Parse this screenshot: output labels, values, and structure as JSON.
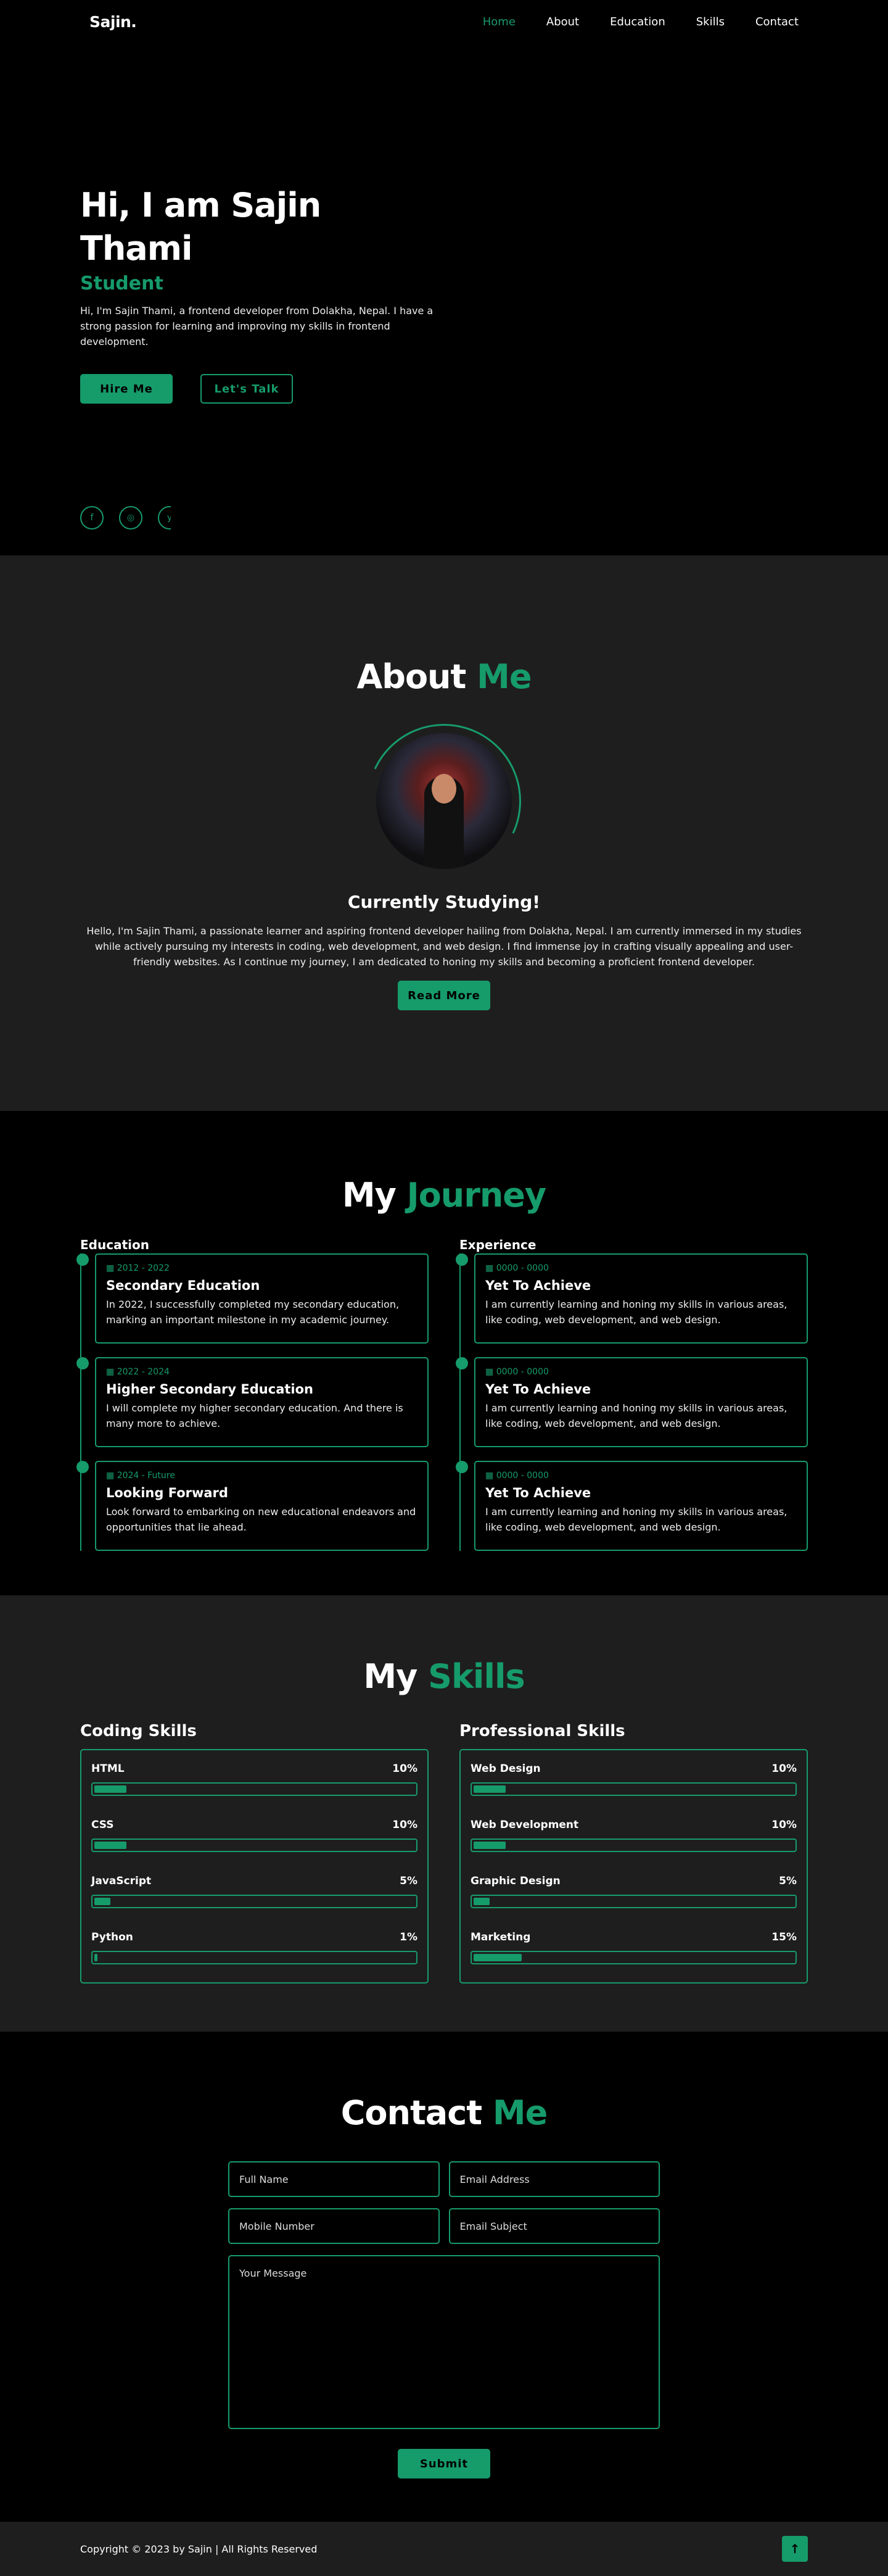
{
  "header": {
    "logo": "Sajin.",
    "nav": [
      "Home",
      "About",
      "Education",
      "Skills",
      "Contact"
    ]
  },
  "hero": {
    "title": "Hi, I am Sajin Thami",
    "role": "Student",
    "bio": "Hi, I'm Sajin Thami, a frontend developer from Dolakha, Nepal. I have a strong passion for learning and improving my skills in frontend development.",
    "hire": "Hire Me",
    "talk": "Let's Talk",
    "social": [
      "f",
      "◎",
      "y"
    ]
  },
  "about": {
    "title1": "About",
    "title2": "Me",
    "heading": "Currently Studying!",
    "text": "Hello, I'm Sajin Thami, a passionate learner and aspiring frontend developer hailing from Dolakha, Nepal. I am currently immersed in my studies while actively pursuing my interests in coding, web development, and web design. I find immense joy in crafting visually appealing and user-friendly websites. As I continue my journey, I am dedicated to honing my skills and becoming a proficient frontend developer.",
    "button": "Read More"
  },
  "journey": {
    "title1": "My",
    "title2": "Journey",
    "education": {
      "label": "Education",
      "items": [
        {
          "date": "2012 - 2022",
          "title": "Secondary Education",
          "text": "In 2022, I successfully completed my secondary education, marking an important milestone in my academic journey."
        },
        {
          "date": "2022 - 2024",
          "title": "Higher Secondary Education",
          "text": "I will complete my higher secondary education. And there is many more to achieve."
        },
        {
          "date": "2024 - Future",
          "title": "Looking Forward",
          "text": "Look forward to embarking on new educational endeavors and opportunities that lie ahead."
        }
      ]
    },
    "experience": {
      "label": "Experience",
      "items": [
        {
          "date": "0000 - 0000",
          "title": "Yet To Achieve",
          "text": "I am currently learning and honing my skills in various areas, like coding, web development, and web design."
        },
        {
          "date": "0000 - 0000",
          "title": "Yet To Achieve",
          "text": "I am currently learning and honing my skills in various areas, like coding, web development, and web design."
        },
        {
          "date": "0000 - 0000",
          "title": "Yet To Achieve",
          "text": "I am currently learning and honing my skills in various areas, like coding, web development, and web design."
        }
      ]
    }
  },
  "skills": {
    "title1": "My",
    "title2": "Skills",
    "coding": {
      "label": "Coding Skills",
      "items": [
        {
          "name": "HTML",
          "pct": "10%",
          "level": 10
        },
        {
          "name": "CSS",
          "pct": "10%",
          "level": 10
        },
        {
          "name": "JavaScript",
          "pct": "5%",
          "level": 5
        },
        {
          "name": "Python",
          "pct": "1%",
          "level": 1
        }
      ]
    },
    "professional": {
      "label": "Professional Skills",
      "items": [
        {
          "name": "Web Design",
          "pct": "10%",
          "level": 10
        },
        {
          "name": "Web Development",
          "pct": "10%",
          "level": 10
        },
        {
          "name": "Graphic Design",
          "pct": "5%",
          "level": 5
        },
        {
          "name": "Marketing",
          "pct": "15%",
          "level": 15
        }
      ]
    }
  },
  "contact": {
    "title1": "Contact",
    "title2": "Me",
    "fullname": "Full Name",
    "email": "Email Address",
    "mobile": "Mobile Number",
    "subject": "Email Subject",
    "message": "Your Message",
    "submit": "Submit"
  },
  "footer": {
    "copyright": "Copyright © 2023 by Sajin | All Rights Reserved",
    "top": "↑"
  },
  "colors": {
    "accent": "#169b6b",
    "dark": "#1f1e1e",
    "bg": "#000000"
  }
}
